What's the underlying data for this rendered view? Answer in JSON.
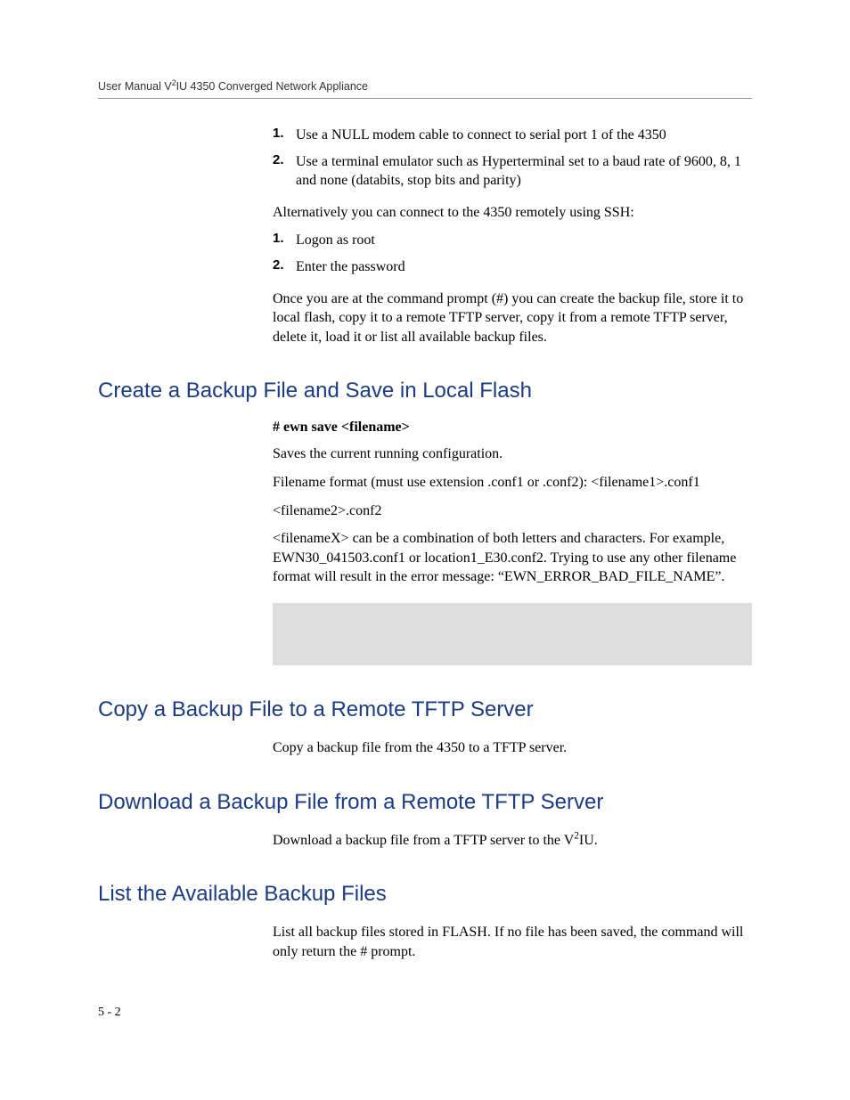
{
  "header": {
    "text_prefix": "User Manual V",
    "text_sup": "2",
    "text_suffix": "IU 4350 Converged Network Appliance"
  },
  "intro": {
    "list1": [
      {
        "num": "1.",
        "text": "Use a NULL modem cable to connect to serial port 1 of the 4350"
      },
      {
        "num": "2.",
        "text": "Use a terminal emulator such as Hyperterminal set to a baud rate of 9600, 8, 1 and none (databits, stop bits and parity)"
      }
    ],
    "alt_para": "Alternatively you can connect to the 4350 remotely using SSH:",
    "list2": [
      {
        "num": "1.",
        "text": "Logon as root"
      },
      {
        "num": "2.",
        "text": "Enter the password"
      }
    ],
    "prompt_para": "Once you are at the command prompt (#) you can create the backup file, store it to local flash, copy it to a remote TFTP server, copy it from a remote TFTP server, delete it, load it or list all available backup files."
  },
  "section1": {
    "heading": "Create a Backup File and Save in Local Flash",
    "cmd": "# ewn save <filename>",
    "p1": "Saves the current running configuration.",
    "p2": "Filename format (must use extension .conf1 or .conf2): <filename1>.conf1",
    "p3": "<filename2>.conf2",
    "p4": "<filenameX> can be a combination of both letters and characters. For example, EWN30_041503.conf1 or location1_E30.conf2. Trying to use any other filename format will result in the error message: “EWN_ERROR_BAD_FILE_NAME”."
  },
  "section2": {
    "heading": "Copy a Backup File to a Remote TFTP Server",
    "p1": "Copy a backup file from the 4350 to a TFTP server."
  },
  "section3": {
    "heading": "Download a Backup File from a Remote TFTP Server",
    "p1_prefix": "Download a backup file from a TFTP server to the V",
    "p1_sup": "2",
    "p1_suffix": "IU."
  },
  "section4": {
    "heading": "List the Available Backup Files",
    "p1": "List all backup files stored in FLASH. If no file has been saved, the command will only return the # prompt."
  },
  "footer": {
    "page": "5 - 2"
  }
}
